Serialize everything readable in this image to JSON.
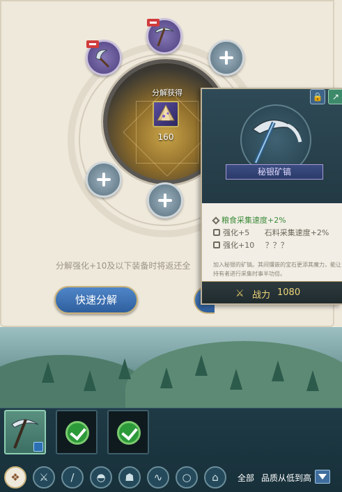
{
  "wheel": {
    "yield_label": "分解获得",
    "yield_item_icon": "crystal-ore-icon",
    "yield_count": "160",
    "slots": [
      {
        "state": "item",
        "icon": "pickaxe-icon",
        "removable": true
      },
      {
        "state": "item",
        "icon": "sickle-icon",
        "removable": true
      },
      {
        "state": "empty",
        "icon": "plus-icon"
      },
      {
        "state": "empty",
        "icon": "plus-icon"
      },
      {
        "state": "empty",
        "icon": "plus-icon"
      }
    ]
  },
  "info_text": "分解强化+10及以下装备时将返还全",
  "buttons": {
    "quick_decompose": "快速分解"
  },
  "item_card": {
    "name": "秘银矿镐",
    "icon": "mithril-pickaxe-icon",
    "stats": [
      {
        "text": "粮食采集速度+2%",
        "icon": "diamond-icon"
      }
    ],
    "enhance_rows": [
      {
        "level": "强化+5",
        "effect": "石料采集速度+2%"
      },
      {
        "level": "强化+10",
        "effect": "？？？"
      }
    ],
    "description": "加入秘银的矿镐。其间镶嵌的宝石更添其魔力，能让持有者进行采集时事半功倍。",
    "power_label": "战力",
    "power_value": "1080"
  },
  "inventory": {
    "items": [
      {
        "icon": "pickaxe-icon",
        "selected": true,
        "equipped": true
      },
      {
        "icon": "checkmark-icon",
        "selected": false
      },
      {
        "icon": "checkmark-icon",
        "selected": false
      }
    ],
    "filters": [
      "all-icon",
      "crossed-weapons-icon",
      "sword-icon",
      "helmet-icon",
      "armor-icon",
      "rope-icon",
      "ring-icon",
      "boots-icon"
    ],
    "filter_all_label": "全部",
    "sort_label": "品质从低到高"
  },
  "colors": {
    "parchment": "#efe9dc",
    "accent_blue": "#3b74b8",
    "power_gold": "#f0d67a",
    "stat_green": "#3e8c3a"
  }
}
